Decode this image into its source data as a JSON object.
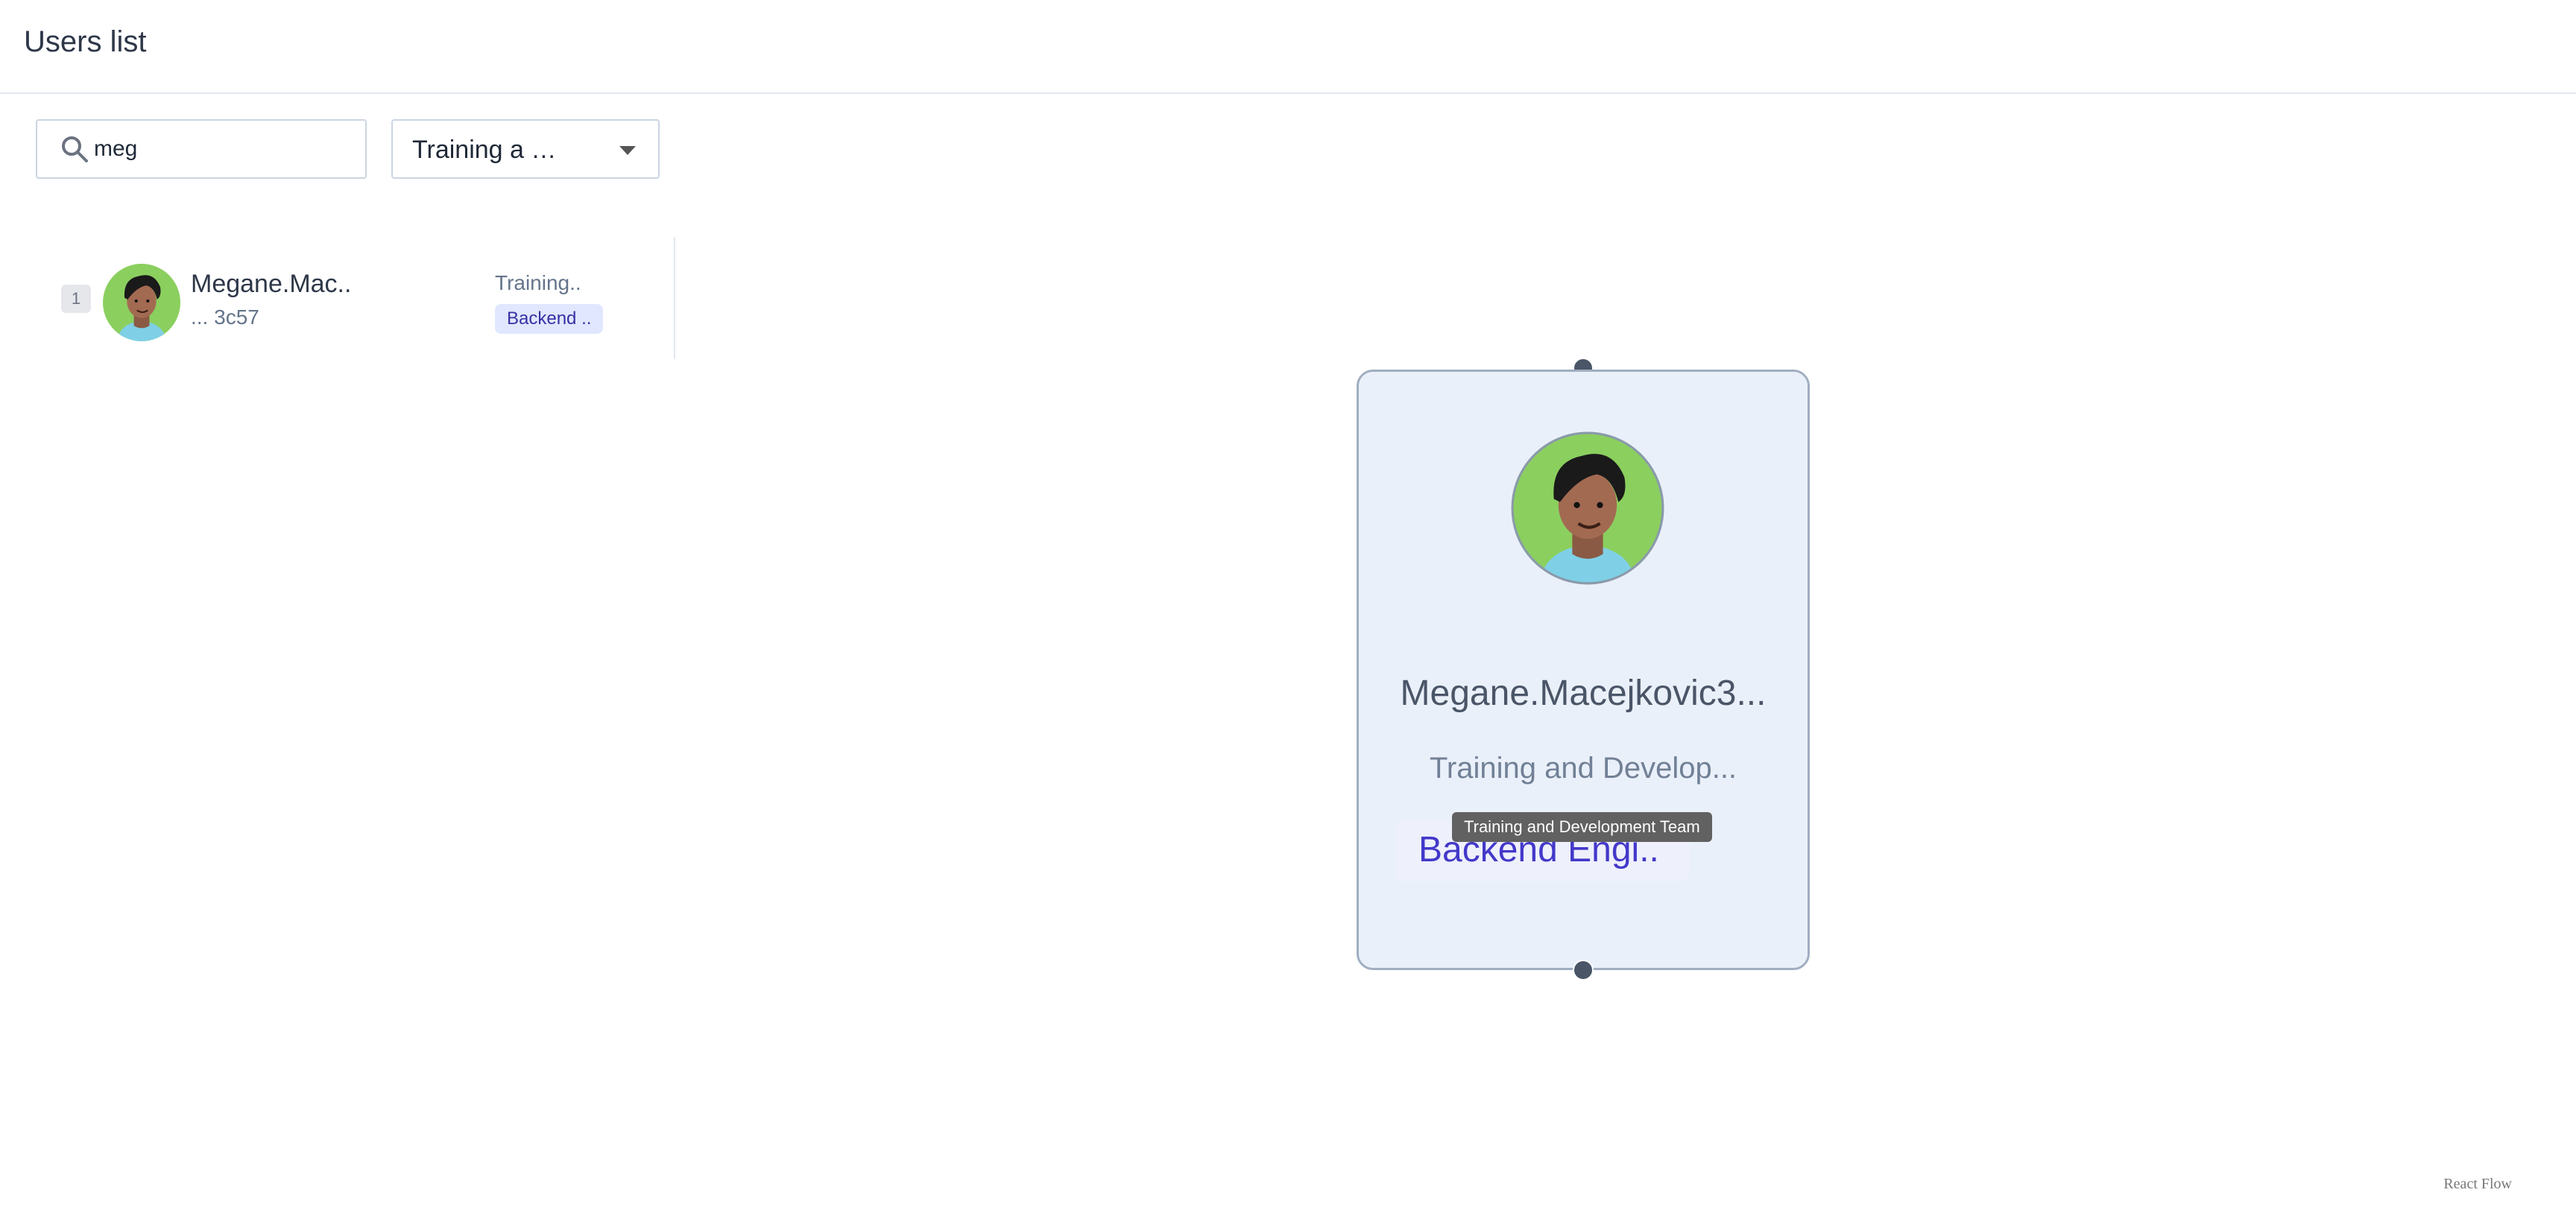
{
  "header": {
    "title": "Users list"
  },
  "filters": {
    "search": {
      "value": "meg",
      "icon": "search-icon"
    },
    "team_select": {
      "value": "Training a  …"
    }
  },
  "list": {
    "rows": [
      {
        "index": "1",
        "name": "Megane.Mac..",
        "id": "... 3c57",
        "team": "Training..",
        "role": "Backend .."
      }
    ]
  },
  "flow": {
    "node": {
      "name": "Megane.Macejkovic3...",
      "team": "Training and Develop...",
      "role": "Backend Engi..",
      "tooltip": "Training and Development Team"
    },
    "attribution": "React Flow"
  },
  "colors": {
    "avatar_bg": "#8bcf5f",
    "handle": "#4a5568",
    "role_text": "#4338ca"
  }
}
